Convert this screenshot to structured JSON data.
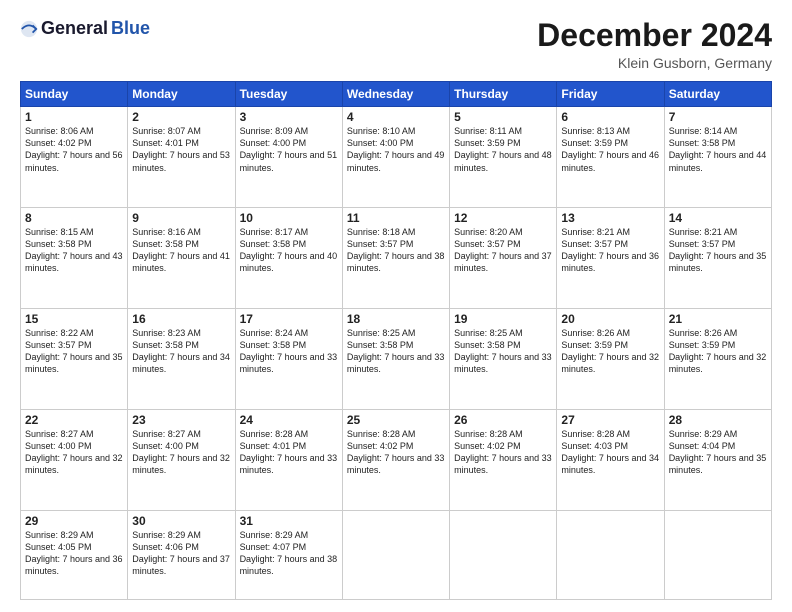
{
  "header": {
    "logo_general": "General",
    "logo_blue": "Blue",
    "month_title": "December 2024",
    "location": "Klein Gusborn, Germany"
  },
  "days_of_week": [
    "Sunday",
    "Monday",
    "Tuesday",
    "Wednesday",
    "Thursday",
    "Friday",
    "Saturday"
  ],
  "weeks": [
    [
      {
        "day": "1",
        "sunrise": "8:06 AM",
        "sunset": "4:02 PM",
        "daylight": "7 hours and 56 minutes."
      },
      {
        "day": "2",
        "sunrise": "8:07 AM",
        "sunset": "4:01 PM",
        "daylight": "7 hours and 53 minutes."
      },
      {
        "day": "3",
        "sunrise": "8:09 AM",
        "sunset": "4:00 PM",
        "daylight": "7 hours and 51 minutes."
      },
      {
        "day": "4",
        "sunrise": "8:10 AM",
        "sunset": "4:00 PM",
        "daylight": "7 hours and 49 minutes."
      },
      {
        "day": "5",
        "sunrise": "8:11 AM",
        "sunset": "3:59 PM",
        "daylight": "7 hours and 48 minutes."
      },
      {
        "day": "6",
        "sunrise": "8:13 AM",
        "sunset": "3:59 PM",
        "daylight": "7 hours and 46 minutes."
      },
      {
        "day": "7",
        "sunrise": "8:14 AM",
        "sunset": "3:58 PM",
        "daylight": "7 hours and 44 minutes."
      }
    ],
    [
      {
        "day": "8",
        "sunrise": "8:15 AM",
        "sunset": "3:58 PM",
        "daylight": "7 hours and 43 minutes."
      },
      {
        "day": "9",
        "sunrise": "8:16 AM",
        "sunset": "3:58 PM",
        "daylight": "7 hours and 41 minutes."
      },
      {
        "day": "10",
        "sunrise": "8:17 AM",
        "sunset": "3:58 PM",
        "daylight": "7 hours and 40 minutes."
      },
      {
        "day": "11",
        "sunrise": "8:18 AM",
        "sunset": "3:57 PM",
        "daylight": "7 hours and 38 minutes."
      },
      {
        "day": "12",
        "sunrise": "8:20 AM",
        "sunset": "3:57 PM",
        "daylight": "7 hours and 37 minutes."
      },
      {
        "day": "13",
        "sunrise": "8:21 AM",
        "sunset": "3:57 PM",
        "daylight": "7 hours and 36 minutes."
      },
      {
        "day": "14",
        "sunrise": "8:21 AM",
        "sunset": "3:57 PM",
        "daylight": "7 hours and 35 minutes."
      }
    ],
    [
      {
        "day": "15",
        "sunrise": "8:22 AM",
        "sunset": "3:57 PM",
        "daylight": "7 hours and 35 minutes."
      },
      {
        "day": "16",
        "sunrise": "8:23 AM",
        "sunset": "3:58 PM",
        "daylight": "7 hours and 34 minutes."
      },
      {
        "day": "17",
        "sunrise": "8:24 AM",
        "sunset": "3:58 PM",
        "daylight": "7 hours and 33 minutes."
      },
      {
        "day": "18",
        "sunrise": "8:25 AM",
        "sunset": "3:58 PM",
        "daylight": "7 hours and 33 minutes."
      },
      {
        "day": "19",
        "sunrise": "8:25 AM",
        "sunset": "3:58 PM",
        "daylight": "7 hours and 33 minutes."
      },
      {
        "day": "20",
        "sunrise": "8:26 AM",
        "sunset": "3:59 PM",
        "daylight": "7 hours and 32 minutes."
      },
      {
        "day": "21",
        "sunrise": "8:26 AM",
        "sunset": "3:59 PM",
        "daylight": "7 hours and 32 minutes."
      }
    ],
    [
      {
        "day": "22",
        "sunrise": "8:27 AM",
        "sunset": "4:00 PM",
        "daylight": "7 hours and 32 minutes."
      },
      {
        "day": "23",
        "sunrise": "8:27 AM",
        "sunset": "4:00 PM",
        "daylight": "7 hours and 32 minutes."
      },
      {
        "day": "24",
        "sunrise": "8:28 AM",
        "sunset": "4:01 PM",
        "daylight": "7 hours and 33 minutes."
      },
      {
        "day": "25",
        "sunrise": "8:28 AM",
        "sunset": "4:02 PM",
        "daylight": "7 hours and 33 minutes."
      },
      {
        "day": "26",
        "sunrise": "8:28 AM",
        "sunset": "4:02 PM",
        "daylight": "7 hours and 33 minutes."
      },
      {
        "day": "27",
        "sunrise": "8:28 AM",
        "sunset": "4:03 PM",
        "daylight": "7 hours and 34 minutes."
      },
      {
        "day": "28",
        "sunrise": "8:29 AM",
        "sunset": "4:04 PM",
        "daylight": "7 hours and 35 minutes."
      }
    ],
    [
      {
        "day": "29",
        "sunrise": "8:29 AM",
        "sunset": "4:05 PM",
        "daylight": "7 hours and 36 minutes."
      },
      {
        "day": "30",
        "sunrise": "8:29 AM",
        "sunset": "4:06 PM",
        "daylight": "7 hours and 37 minutes."
      },
      {
        "day": "31",
        "sunrise": "8:29 AM",
        "sunset": "4:07 PM",
        "daylight": "7 hours and 38 minutes."
      },
      null,
      null,
      null,
      null
    ]
  ]
}
